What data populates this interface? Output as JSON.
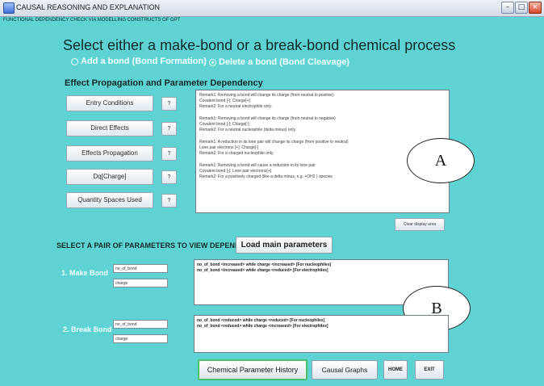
{
  "window": {
    "title": "CAUSAL REASONING AND EXPLANATION",
    "subtitle": "FUNCTIONAL DEPENDENCY CHECK VIA MODELLING CONSTRUCTS OF GPT",
    "controls": {
      "minimize": "–",
      "maximize": "□",
      "close": "×"
    }
  },
  "main": {
    "heading": "Select either a make-bond or a break-bond chemical process",
    "radio_add": "Add a bond (Bond Formation)",
    "radio_delete": "Delete a bond (Bond Cleavage)",
    "selected_radio": "delete"
  },
  "effect": {
    "heading": "Effect Propagation and Parameter Dependency",
    "buttons": [
      {
        "label": "Entry Conditions",
        "help": "?"
      },
      {
        "label": "Direct Effects",
        "help": "?"
      },
      {
        "label": "Effects Propagation",
        "help": "?"
      },
      {
        "label": "Dq[Charge]",
        "help": "?"
      },
      {
        "label": "Quantity Spaces Used",
        "help": "?"
      }
    ],
    "display_lines": [
      "Remark1: Removing a bond will change its charge (from neutral to positive)",
      "Covalent bond [-]: Charge[+]",
      "Remark2: For a neutral electrophile only.",
      "",
      "Remark1: Removing a bond will change its charge (from neutral to negative)",
      "Covalent bond [-]: Charge[-]",
      "Remark2: For a neutral nucleophile (delta minus) only.",
      "",
      "Remark1: A reduction in its lone pair will change its charge (from positive to neutral)",
      "Lone pair electrons [+]: Charge[-]",
      "Remark2: For a charged nucleophile only.",
      "",
      "Remark1: Removing a bond will cause a reduction in its lone pair",
      "Covalent bond [-]: Lone pair electrons[+]",
      "Remark2: For a positively charged (like a delta minus, e.g. +OH2 ) species"
    ],
    "clear_button": "Clear display area"
  },
  "annotations": {
    "a": "A",
    "b": "B"
  },
  "pairs": {
    "heading": "SELECT A PAIR OF PARAMETERS TO VIEW DEPENDENCY",
    "load_button": "Load main parameters",
    "make": {
      "label": "1. Make Bond",
      "param1": "no_of_bond",
      "param2": "charge",
      "lines": [
        "no_of_bond <increased> while charge <increased> [For nucleophiles]",
        "no_of_bond <increased> while charge <reduced> [For electrophiles]"
      ]
    },
    "break": {
      "label": "2. Break Bond",
      "param1": "no_of_bond",
      "param2": "charge",
      "lines": [
        "no_of_bond <reduced> while charge <reduced> [For nucleophiles]",
        "no_of_bond <reduced> while charge <increased> [For electrophiles]"
      ]
    }
  },
  "bottom": {
    "history": "Chemical Parameter History",
    "graphs": "Causal Graphs",
    "home": "HOME",
    "exit": "EXIT"
  }
}
